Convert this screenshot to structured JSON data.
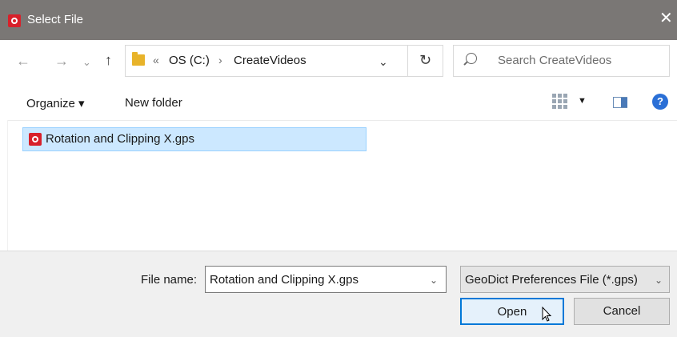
{
  "window": {
    "title": "Select File"
  },
  "nav": {
    "path_prefix": "«",
    "drive": "OS (C:)",
    "separator": "›",
    "folder": "CreateVideos",
    "search_placeholder": "Search CreateVideos"
  },
  "toolbar": {
    "organize_label": "Organize ▾",
    "new_folder_label": "New folder",
    "help_label": "?"
  },
  "files": [
    {
      "name": "Rotation and Clipping X.gps",
      "selected": true
    }
  ],
  "footer": {
    "file_name_label": "File name:",
    "file_name_value": "Rotation and Clipping X.gps",
    "file_type_value": "GeoDict Preferences File (*.gps)",
    "open_label": "Open",
    "cancel_label": "Cancel"
  },
  "colors": {
    "titlebar": "#7a7775",
    "selection": "#cce8ff",
    "accent": "#0078d7",
    "brand_red": "#d8202a"
  },
  "icons": [
    "app-logo-icon",
    "back-arrow-icon",
    "forward-arrow-icon",
    "recent-dropdown-icon",
    "up-arrow-icon",
    "folder-icon",
    "chevron-down-icon",
    "refresh-icon",
    "search-icon",
    "view-grid-icon",
    "preview-pane-icon",
    "help-icon",
    "file-gps-icon",
    "mouse-cursor-icon",
    "close-icon"
  ]
}
